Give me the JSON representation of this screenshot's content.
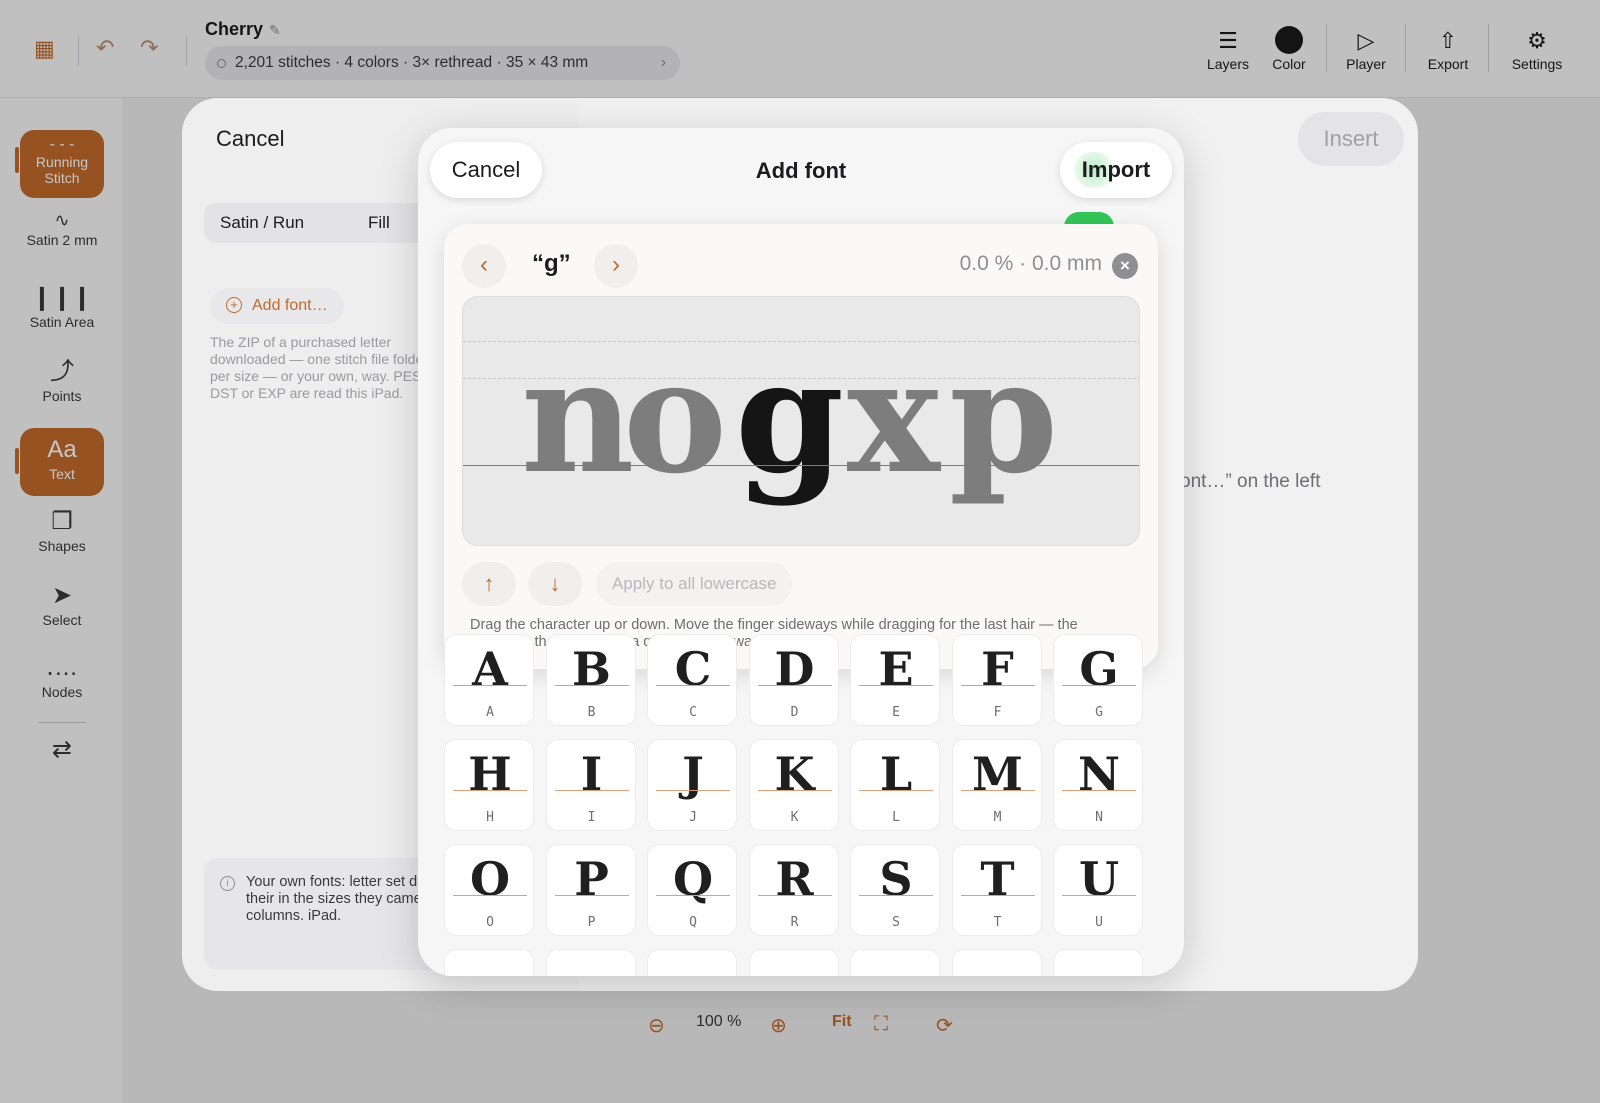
{
  "app": {
    "document_title": "Cherry",
    "stats": "2,201 stitches · 4 colors · 3× rethread · 35 × 43 mm",
    "toolbar_right": [
      {
        "id": "layers",
        "label": "Layers",
        "icon": "layers-icon"
      },
      {
        "id": "color",
        "label": "Color",
        "icon": "color-swatch",
        "color": "#1a1a1a"
      },
      {
        "id": "player",
        "label": "Player",
        "icon": "play-icon"
      },
      {
        "id": "export",
        "label": "Export",
        "icon": "share-icon"
      },
      {
        "id": "settings",
        "label": "Settings",
        "icon": "gear-icon"
      }
    ],
    "tools": [
      {
        "label": "Running Stitch",
        "icon": "running-stitch-icon",
        "active": true
      },
      {
        "label": "Satin 2 mm",
        "icon": "satin-icon",
        "active": false
      },
      {
        "label": "Satin Area",
        "icon": "satin-area-icon",
        "active": false
      },
      {
        "label": "Points",
        "icon": "points-icon",
        "active": false
      },
      {
        "label": "Text",
        "icon": "text-icon",
        "active": true
      },
      {
        "label": "Shapes",
        "icon": "shapes-icon",
        "active": false
      },
      {
        "label": "Select",
        "icon": "pointer-icon",
        "active": false
      },
      {
        "label": "Nodes",
        "icon": "nodes-icon",
        "active": false
      }
    ],
    "zoom": {
      "value": "100 %",
      "fit_label": "Fit"
    }
  },
  "text_sheet": {
    "cancel_label": "Cancel",
    "insert_label": "Insert",
    "segments": [
      "Satin / Run",
      "Fill"
    ],
    "add_font_label": "Add font…",
    "help_text": "The ZIP of a purchased letter downloaded — one stitch file folder per size — or your own, way. PES, DST or EXP are read this iPad.",
    "info_text": "Your own fonts: letter set digitized, which sew their in the sizes they came in, fonts with satin columns. iPad.",
    "right_hint": "ont…” on the left"
  },
  "add_font": {
    "title": "Add font",
    "cancel_label": "Cancel",
    "import_label": "Import",
    "editor": {
      "glyph_label": "“g”",
      "readout": "0.0 % · 0.0 mm",
      "preview_chars": [
        "n",
        "o",
        "g",
        "x",
        "p"
      ],
      "selected_char": "g",
      "apply_label": "Apply to all lowercase",
      "help": "Drag the character up or down. Move the finger sideways while dragging for the last hair — the character then follows at a quarter of the way."
    },
    "letters": [
      "A",
      "B",
      "C",
      "D",
      "E",
      "F",
      "G",
      "H",
      "I",
      "J",
      "K",
      "L",
      "M",
      "N",
      "O",
      "P",
      "Q",
      "R",
      "S",
      "T",
      "U"
    ]
  }
}
